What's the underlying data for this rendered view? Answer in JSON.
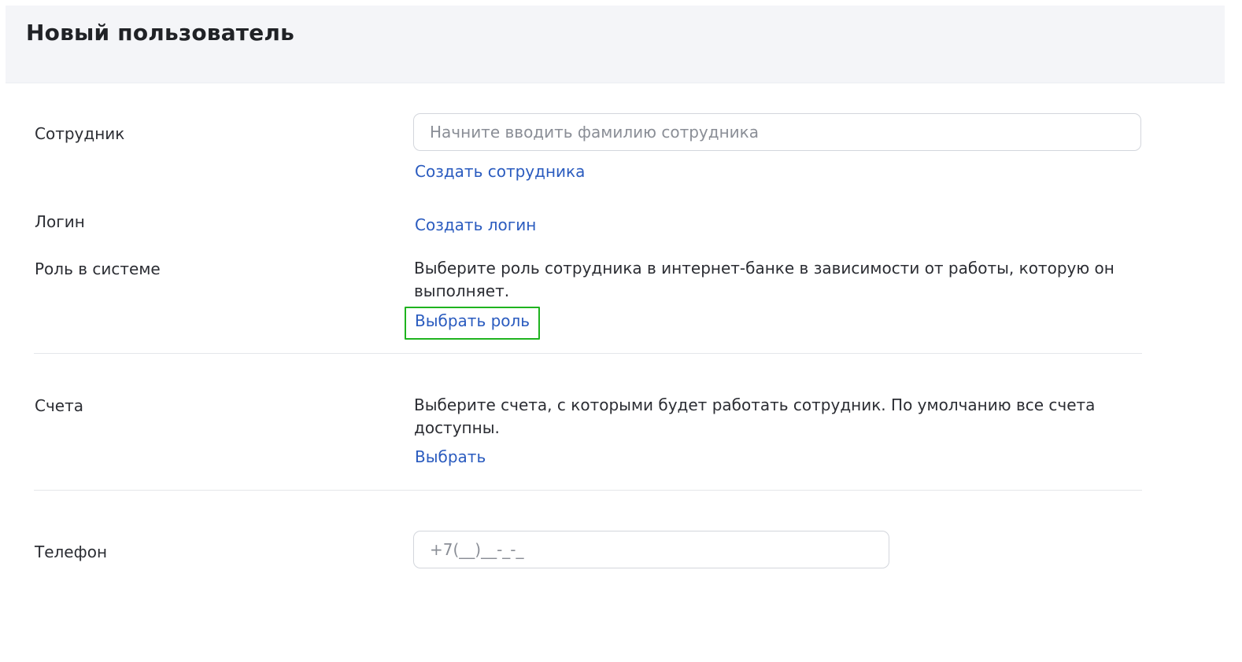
{
  "header": {
    "title": "Новый пользователь"
  },
  "employee": {
    "label": "Сотрудник",
    "placeholder": "Начните вводить фамилию сотрудника",
    "create_link": "Создать сотрудника"
  },
  "login": {
    "label": "Логин",
    "create_link": "Создать логин"
  },
  "role": {
    "label": "Роль в системе",
    "description": "Выберите роль сотрудника в интернет-банке в зависимости от работы, которую он выполняет.",
    "select_link": "Выбрать роль"
  },
  "accounts": {
    "label": "Счета",
    "description": "Выберите счета, с которыми будет работать сотрудник. По умолчанию все счета доступны.",
    "select_link": "Выбрать"
  },
  "phone": {
    "label": "Телефон",
    "placeholder": "+7(__)__-_-_"
  },
  "colors": {
    "header_bg": "#f4f5f8",
    "link": "#2a5bbf",
    "highlight": "#1fb31f",
    "text": "#2b2d33"
  }
}
